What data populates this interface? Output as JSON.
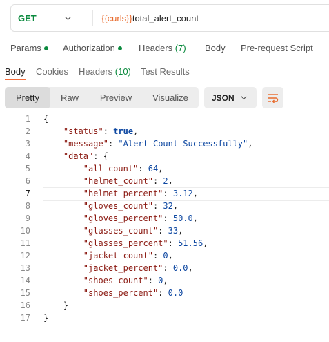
{
  "request": {
    "method": "GET",
    "url_variable": "{{curls}}",
    "url_path": "total_alert_count"
  },
  "request_tabs": {
    "params": "Params",
    "authorization": "Authorization",
    "headers": "Headers",
    "headers_count": "(7)",
    "body": "Body",
    "pre_request": "Pre-request Script"
  },
  "response_tabs": {
    "body": "Body",
    "cookies": "Cookies",
    "headers": "Headers",
    "headers_count": "(10)",
    "test_results": "Test Results"
  },
  "view_modes": {
    "pretty": "Pretty",
    "raw": "Raw",
    "preview": "Preview",
    "visualize": "Visualize"
  },
  "format_select": {
    "value": "JSON"
  },
  "colors": {
    "method": "#0b8a3e",
    "url_variable": "#e8692a",
    "active_underline": "#f26b3a",
    "json_key": "#8b1a12",
    "json_value": "#0d47a1"
  },
  "response_json": {
    "status": "true",
    "message": "\"Alert Count Successfully\"",
    "data": {
      "all_count": "64",
      "helmet_count": "2",
      "helmet_percent": "3.12",
      "gloves_count": "32",
      "gloves_percent": "50.0",
      "glasses_count": "33",
      "glasses_percent": "51.56",
      "jacket_count": "0",
      "jacket_percent": "0.0",
      "shoes_count": "0",
      "shoes_percent": "0.0"
    }
  },
  "line_numbers": [
    "1",
    "2",
    "3",
    "4",
    "5",
    "6",
    "7",
    "8",
    "9",
    "10",
    "11",
    "12",
    "13",
    "14",
    "15",
    "16",
    "17"
  ],
  "current_line": "7"
}
